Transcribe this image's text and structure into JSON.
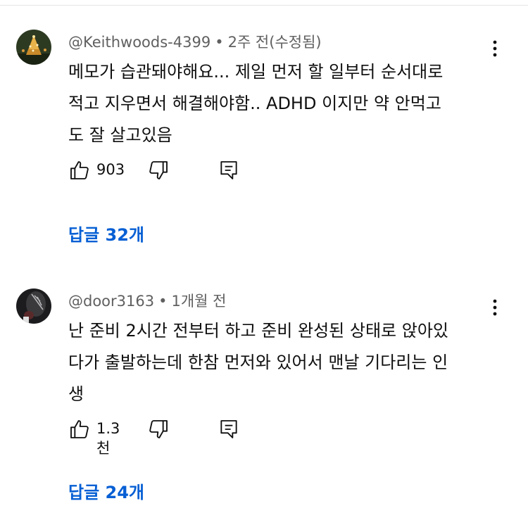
{
  "comments": [
    {
      "author": "@Keithwoods-4399",
      "time": "2주 전(수정됨)",
      "text": "메모가 습관돼야해요... 제일 먼저 할 일부터 순서대로\n적고 지우면서 해결해야함.. ADHD 이지만 약 안먹고\n도 잘 살고있음",
      "likes": "903",
      "replies": "답글 32개"
    },
    {
      "author": "@door3163",
      "time": "1개월 전",
      "text": "난 준비 2시간 전부터 하고 준비 완성된 상태로 앉아있\n다가 출발하는데 한참 먼저와 있어서 맨날 기다리는 인\n생",
      "likes": "1.3천",
      "replies": "답글 24개"
    }
  ],
  "separator": "•",
  "icons": {
    "like": "thumbs-up-icon",
    "dislike": "thumbs-down-icon",
    "reply": "reply-icon",
    "more": "more-vert-icon"
  },
  "colors": {
    "link": "#065fd4",
    "meta": "#606060",
    "text": "#0f0f0f"
  }
}
